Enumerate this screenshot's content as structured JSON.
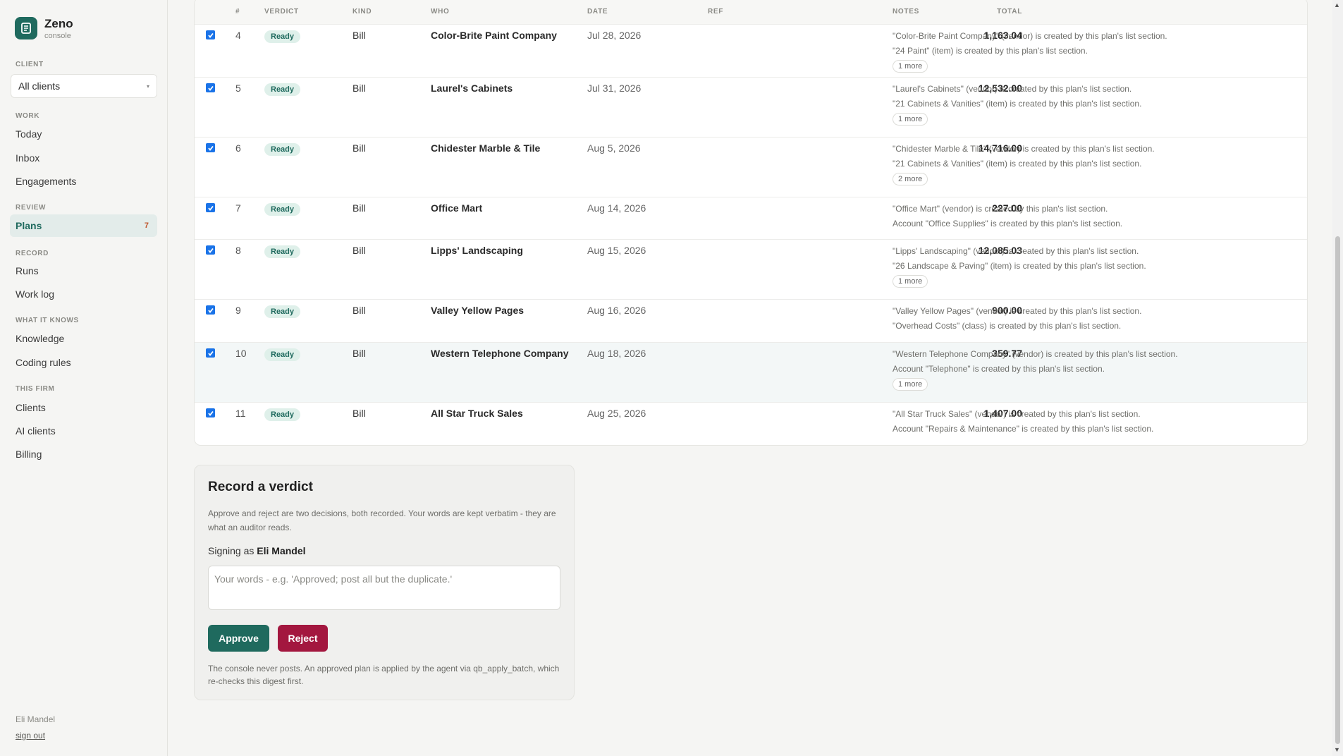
{
  "app": {
    "name": "Zeno",
    "subtitle": "console"
  },
  "sidebar": {
    "client_label": "CLIENT",
    "client_select": "All clients",
    "sections": {
      "work": "WORK",
      "review": "REVIEW",
      "record": "RECORD",
      "knows": "WHAT IT KNOWS",
      "firm": "THIS FIRM"
    },
    "items": {
      "today": "Today",
      "inbox": "Inbox",
      "engagements": "Engagements",
      "plans": "Plans",
      "plans_badge": "7",
      "runs": "Runs",
      "worklog": "Work log",
      "knowledge": "Knowledge",
      "coding_rules": "Coding rules",
      "clients": "Clients",
      "ai_clients": "AI clients",
      "billing": "Billing"
    },
    "user": "Eli Mandel",
    "signout": "sign out"
  },
  "table": {
    "headers": {
      "num": "#",
      "verdict": "VERDICT",
      "kind": "KIND",
      "who": "WHO",
      "date": "DATE",
      "ref": "REF",
      "total": "TOTAL",
      "notes": "NOTES"
    },
    "rows": [
      {
        "num": "4",
        "verdict": "Ready",
        "kind": "Bill",
        "who": "Color-Brite Paint Company",
        "date": "Jul 28, 2026",
        "ref": "",
        "total": "1,163.04",
        "note1": "\"Color-Brite Paint Company\" (vendor) is created by this plan's list section.",
        "note2": "\"24 Paint\" (item) is created by this plan's list section.",
        "more": "1 more"
      },
      {
        "num": "5",
        "verdict": "Ready",
        "kind": "Bill",
        "who": "Laurel's Cabinets",
        "date": "Jul 31, 2026",
        "ref": "",
        "total": "12,532.00",
        "note1": "\"Laurel's Cabinets\" (vendor) is created by this plan's list section.",
        "note2": "\"21 Cabinets & Vanities\" (item) is created by this plan's list section.",
        "more": "1 more"
      },
      {
        "num": "6",
        "verdict": "Ready",
        "kind": "Bill",
        "who": "Chidester Marble & Tile",
        "date": "Aug 5, 2026",
        "ref": "",
        "total": "14,716.00",
        "note1": "\"Chidester Marble & Tile\" (vendor) is created by this plan's list section.",
        "note2": "\"21 Cabinets & Vanities\" (item) is created by this plan's list section.",
        "more": "2 more"
      },
      {
        "num": "7",
        "verdict": "Ready",
        "kind": "Bill",
        "who": "Office Mart",
        "date": "Aug 14, 2026",
        "ref": "",
        "total": "227.00",
        "note1": "\"Office Mart\" (vendor) is created by this plan's list section.",
        "note2": "Account \"Office Supplies\" is created by this plan's list section."
      },
      {
        "num": "8",
        "verdict": "Ready",
        "kind": "Bill",
        "who": "Lipps' Landscaping",
        "date": "Aug 15, 2026",
        "ref": "",
        "total": "12,085.03",
        "note1": "\"Lipps' Landscaping\" (vendor) is created by this plan's list section.",
        "note2": "\"26 Landscape & Paving\" (item) is created by this plan's list section.",
        "more": "1 more"
      },
      {
        "num": "9",
        "verdict": "Ready",
        "kind": "Bill",
        "who": "Valley Yellow Pages",
        "date": "Aug 16, 2026",
        "ref": "",
        "total": "900.00",
        "note1": "\"Valley Yellow Pages\" (vendor) is created by this plan's list section.",
        "note2": "\"Overhead Costs\" (class) is created by this plan's list section."
      },
      {
        "num": "10",
        "verdict": "Ready",
        "kind": "Bill",
        "who": "Western Telephone Company",
        "date": "Aug 18, 2026",
        "ref": "",
        "total": "359.77",
        "note1": "\"Western Telephone Company\" (vendor) is created by this plan's list section.",
        "note2": "Account \"Telephone\" is created by this plan's list section.",
        "more": "1 more"
      },
      {
        "num": "11",
        "verdict": "Ready",
        "kind": "Bill",
        "who": "All Star Truck Sales",
        "date": "Aug 25, 2026",
        "ref": "",
        "total": "1,407.00",
        "note1": "\"All Star Truck Sales\" (vendor) is created by this plan's list section.",
        "note2": "Account \"Repairs & Maintenance\" is created by this plan's list section."
      }
    ]
  },
  "verdict": {
    "title": "Record a verdict",
    "description": "Approve and reject are two decisions, both recorded. Your words are kept verbatim - they are what an auditor reads.",
    "signing_prefix": "Signing as",
    "signer": "Eli Mandel",
    "placeholder": "Your words - e.g. 'Approved; post all but the duplicate.'",
    "approve": "Approve",
    "reject": "Reject",
    "footer": "The console never posts. An approved plan is applied by the agent via qb_apply_batch, which re-checks this digest first."
  },
  "colors": {
    "accent": "#1f6a5e",
    "reject": "#a3173f",
    "checkbox": "#1a73e8"
  }
}
